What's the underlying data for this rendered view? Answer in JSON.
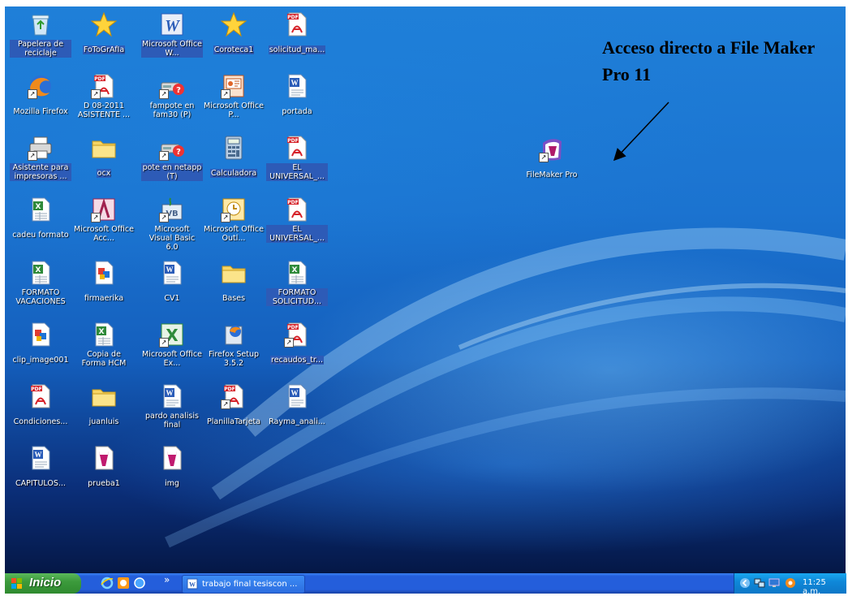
{
  "desktop": {
    "icons": [
      {
        "label": "Papelera de reciclaje",
        "icon": "recycle-bin-icon"
      },
      {
        "label": "FoToGrAfIa",
        "icon": "star-icon"
      },
      {
        "label": "Microsoft Office W...",
        "icon": "word-app-icon"
      },
      {
        "label": "Coroteca1",
        "icon": "star-icon"
      },
      {
        "label": "solicitud_ma...",
        "icon": "pdf-icon"
      },
      {
        "label": "Mozilla Firefox",
        "icon": "firefox-icon"
      },
      {
        "label": "D 08-2011 ASISTENTE ...",
        "icon": "pdf-icon"
      },
      {
        "label": "fampote en fam30 (P)",
        "icon": "network-drive-icon"
      },
      {
        "label": "Microsoft Office P...",
        "icon": "powerpoint-icon"
      },
      {
        "label": "portada",
        "icon": "word-doc-icon"
      },
      {
        "label": "Asistente para impresoras ...",
        "icon": "printer-icon"
      },
      {
        "label": "ocx",
        "icon": "folder-icon"
      },
      {
        "label": "pote en netapp (T)",
        "icon": "network-drive-icon"
      },
      {
        "label": "Calculadora",
        "icon": "calculator-icon"
      },
      {
        "label": "EL UNIVERSAL_...",
        "icon": "pdf-icon"
      },
      {
        "label": "cadeu formato",
        "icon": "excel-doc-icon"
      },
      {
        "label": "Microsoft Office Acc...",
        "icon": "access-icon"
      },
      {
        "label": "Microsoft Visual Basic 6.0",
        "icon": "visual-basic-icon"
      },
      {
        "label": "Microsoft Office Outl...",
        "icon": "outlook-icon"
      },
      {
        "label": "EL UNIVERSAL_...",
        "icon": "pdf-icon"
      },
      {
        "label": "FORMATO VACACIONES",
        "icon": "excel-doc-icon"
      },
      {
        "label": "firmaerika",
        "icon": "image-icon"
      },
      {
        "label": "CV1",
        "icon": "word-doc-icon"
      },
      {
        "label": "Bases",
        "icon": "folder-icon"
      },
      {
        "label": "FORMATO SOLICITUD...",
        "icon": "excel-doc-icon"
      },
      {
        "label": "clip_image001",
        "icon": "image-icon"
      },
      {
        "label": "Copia de Forma HCM",
        "icon": "excel-doc-icon"
      },
      {
        "label": "Microsoft Office Ex...",
        "icon": "excel-app-icon"
      },
      {
        "label": "Firefox Setup 3.5.2",
        "icon": "installer-icon"
      },
      {
        "label": "recaudos_tr...",
        "icon": "pdf-icon"
      },
      {
        "label": "Condiciones...",
        "icon": "pdf-icon"
      },
      {
        "label": "juanluis",
        "icon": "folder-icon"
      },
      {
        "label": "pardo analisis final",
        "icon": "word-doc-icon"
      },
      {
        "label": "PlanillaTarjeta",
        "icon": "pdf-icon"
      },
      {
        "label": "Rayma_anali...",
        "icon": "word-doc-icon"
      },
      {
        "label": "CAPITULOS...",
        "icon": "word-doc-icon"
      },
      {
        "label": "prueba1",
        "icon": "filemaker-doc-icon"
      },
      {
        "label": "img",
        "icon": "filemaker-doc-icon"
      },
      {
        "label": "FileMaker Pro",
        "icon": "filemaker-icon"
      }
    ]
  },
  "annotation": {
    "text": "Acceso directo a File Maker Pro 11"
  },
  "taskbar": {
    "start_label": "Inicio",
    "quick_launch": [
      "internet-explorer-icon",
      "media-icon",
      "browser-icon"
    ],
    "overflow": "»",
    "task_label": "trabajo final tesiscon ...",
    "clock": "11:25 a.m.",
    "tray_icons": [
      "arrow-left-icon",
      "network-icon",
      "display-icon",
      "security-icon"
    ]
  },
  "colors": {
    "desktop_blue": "#1b73d0",
    "taskbar_blue": "#245edb",
    "start_green": "#3c9b3c",
    "tray_blue": "#0f88d9"
  }
}
